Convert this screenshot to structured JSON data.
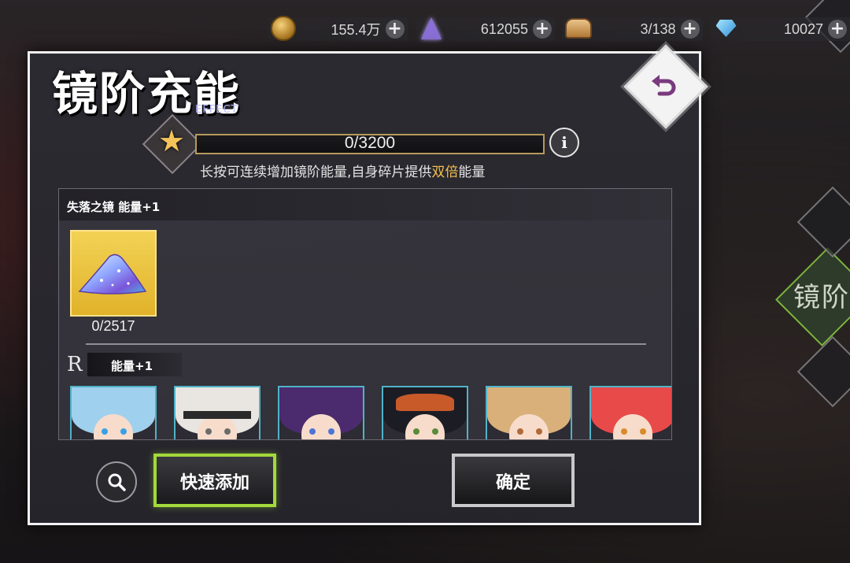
{
  "resources": [
    {
      "name": "coin-icon",
      "value": "155.4万"
    },
    {
      "name": "crystal-icon",
      "value": "612055"
    },
    {
      "name": "bread-icon",
      "value": "3/138"
    },
    {
      "name": "gem-icon",
      "value": "10027"
    }
  ],
  "dialog": {
    "title": "镜阶充能",
    "effect_label": "EFFECT",
    "energy": {
      "current": 0,
      "max": 3200,
      "text": "0/3200"
    },
    "info_label": "i",
    "hint_prefix": "长按可连续增加镜阶能量,自身碎片提供",
    "hint_highlight": "双倍",
    "hint_suffix": "能量",
    "sections": {
      "mirror": {
        "title": "失落之镜  能量+1",
        "item_count": "0/2517"
      },
      "rank": {
        "tag": "R",
        "energy": "能量+1"
      }
    },
    "buttons": {
      "quick_add": "快速添加",
      "confirm": "确定"
    }
  },
  "background": {
    "side_label": "镜阶"
  },
  "colors": {
    "accent_green": "#a3d93a",
    "highlight_orange": "#f4bf4b",
    "card_gold": "#e1b22a",
    "portrait_border": "#4fb3c8"
  }
}
